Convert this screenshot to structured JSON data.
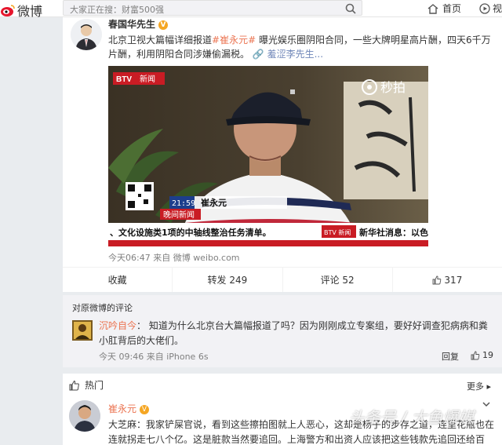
{
  "header": {
    "logo_text": "微博",
    "search_placeholder": "大家正在搜：财富500强",
    "nav_home": "首页",
    "nav_video": "视"
  },
  "post": {
    "author": "春国华先生",
    "text_before": "北京卫视大篇幅详细报道",
    "topic": "#崔永元#",
    "text_after": " 曝光娱乐圈阴阳合同，一些大牌明星高片酬，四天6千万片酬，利用阴阳合同涉嫌偷漏税。",
    "link_text": "羞涩李先生...",
    "video": {
      "channel_logo": "BTV",
      "channel_label": "新闻",
      "watermark": "秒拍",
      "time": "21:59",
      "speaker": "崔永元",
      "program": "晚间新闻",
      "ticker_left": "、文化设施类1项的中轴线整治任务清单。",
      "ticker_logo": "BTV 新闻",
      "ticker_right": "新华社消息：以色列国"
    },
    "meta": "今天06:47 来自 微博 weibo.com",
    "actions": {
      "favorite": "收藏",
      "repost": "转发 249",
      "comment": "评论 52",
      "like": "317"
    }
  },
  "original_comments": {
    "title": "对原微博的评论",
    "user": "沉吟自今",
    "text": "：  知道为什么北京台大篇幅报道了吗？因为刚刚成立专案组，要好好调查犯病病和粪小肛背后的大佬们。",
    "time": "今天 09:46 来自 iPhone 6s",
    "reply": "回复",
    "likes": "19"
  },
  "hot": {
    "title": "热门",
    "more": "更多",
    "user": "崔永元",
    "text": "大芝麻：我家铲屎官说，看到这些擦拍图就上人恶心，这却是杨子的步存之道，连里花瓶也在连就拐走七八个亿。这是脏款当然要追回。上海警方和出资人应该把这些钱款先追回还给百姓。",
    "watermark": "头条号 / 大鱼爆媒"
  },
  "colors": {
    "accent_orange": "#eb7350",
    "link_blue": "#6f86b8",
    "verified_gold": "#f5a623"
  }
}
